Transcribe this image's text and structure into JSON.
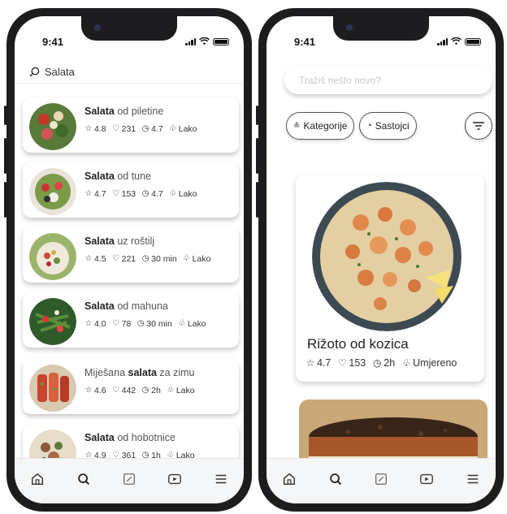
{
  "status": {
    "time": "9:41"
  },
  "left": {
    "search_query": "Salata",
    "recipes": [
      {
        "bold": "Salata",
        "rest_before": "",
        "rest_after": " od piletine",
        "rating": "4.8",
        "likes": "231",
        "time": "4.7",
        "difficulty": "Lako"
      },
      {
        "bold": "Salata",
        "rest_before": "",
        "rest_after": " od tune",
        "rating": "4.7",
        "likes": "153",
        "time": "4.7",
        "difficulty": "Lako"
      },
      {
        "bold": "Salata",
        "rest_before": "",
        "rest_after": " uz roštilj",
        "rating": "4.5",
        "likes": "221",
        "time": "30 min",
        "difficulty": "Lako"
      },
      {
        "bold": "Salata",
        "rest_before": "",
        "rest_after": " od mahuna",
        "rating": "4.0",
        "likes": "78",
        "time": "30 min",
        "difficulty": "Lako"
      },
      {
        "bold": "salata",
        "rest_before": "Miješana ",
        "rest_after": " za zimu",
        "rating": "4.6",
        "likes": "442",
        "time": "2h",
        "difficulty": "Lako"
      },
      {
        "bold": "Salata",
        "rest_before": "",
        "rest_after": " od hobotnice",
        "rating": "4.9",
        "likes": "361",
        "time": "1h",
        "difficulty": "Lako"
      }
    ]
  },
  "right": {
    "search_placeholder": "Tražiš nešto novo?",
    "chips": {
      "categories": "Kategorije",
      "ingredients": "Sastojci"
    },
    "featured": {
      "title": "Rižoto od kozica",
      "rating": "4.7",
      "likes": "153",
      "time": "2h",
      "difficulty": "Umjereno"
    }
  },
  "icons": {
    "tabs": [
      "home-icon",
      "search-icon",
      "edit-icon",
      "play-icon",
      "menu-icon"
    ]
  }
}
